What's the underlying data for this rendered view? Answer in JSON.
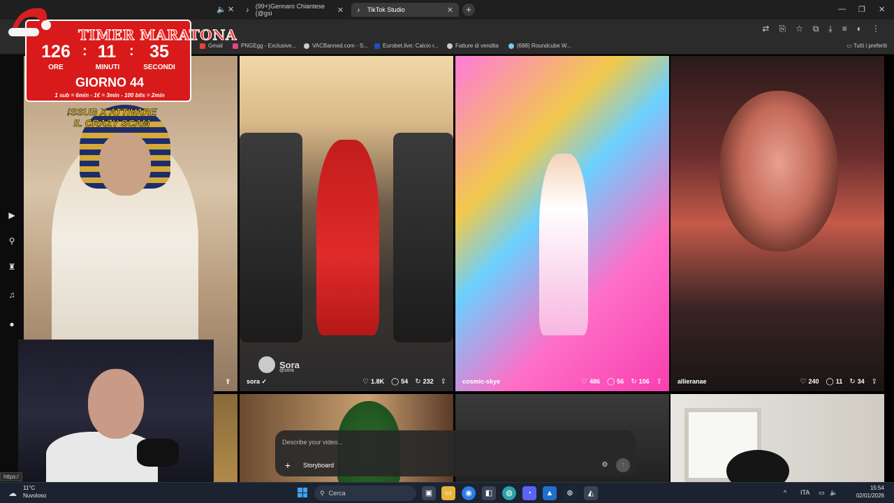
{
  "browser": {
    "tabs": [
      {
        "label": "(99+)Gennaro Chiantese (@gsi",
        "active": false
      },
      {
        "label": "TikTok Studio",
        "active": false
      }
    ],
    "bookmarks": [
      {
        "label": "Gmail"
      },
      {
        "label": "PNGEgg - Exclusive..."
      },
      {
        "label": "VACBanned.com - S..."
      },
      {
        "label": "Eurobet.live: Calcio r..."
      },
      {
        "label": "Fatture di vendita"
      },
      {
        "label": "(688) Roundcube W..."
      }
    ],
    "bookmarks_right": "Tutti i preferiti",
    "status_url": "https:/"
  },
  "timer": {
    "title": "TIMER MARATONA",
    "hours": "126",
    "minutes": "11",
    "seconds": "35",
    "hours_label": "ORE",
    "minutes_label": "MINUTI",
    "seconds_label": "SECONDI",
    "day": "GIORNO 44",
    "rates": "1 sub = 6min - 1€ = 3min - 100 bits = 2min"
  },
  "overlay_text": "!SSUB X ATTIVARE IL CRAZY SCAM",
  "feed": {
    "cards": [
      {
        "user": "sora",
        "verified": true,
        "likes": "1.8K",
        "comments": "54",
        "remixes": "232"
      },
      {
        "user": "cosmic-skye",
        "verified": false,
        "likes": "486",
        "comments": "56",
        "remixes": "106"
      },
      {
        "user": "allieranae",
        "verified": false,
        "likes": "240",
        "comments": "11",
        "remixes": "34"
      }
    ],
    "watermark": {
      "name": "Sora",
      "handle": "@sora"
    }
  },
  "prompt": {
    "placeholder": "Describe your video...",
    "storyboard_label": "Storyboard"
  },
  "taskbar": {
    "temperature": "11°C",
    "weather": "Nuvoloso",
    "search_label": "Cerca",
    "language": "ITA",
    "time": "15:54",
    "date": "02/01/2026"
  },
  "colors": {
    "timer_red": "#d91a1a",
    "overlay_yellow": "#f5d33a",
    "taskbar": "#1c2330"
  }
}
